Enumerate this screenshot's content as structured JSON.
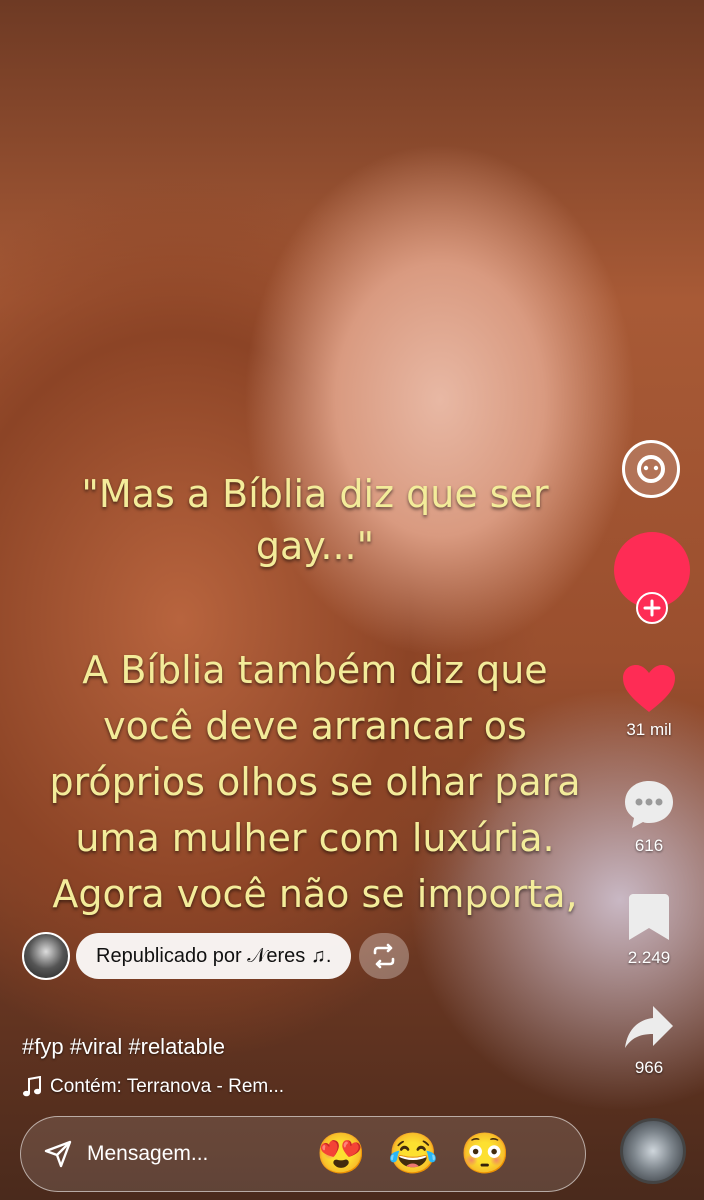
{
  "caption": {
    "quote_lines": [
      "\"Mas a Bíblia diz que ser",
      "gay...\""
    ],
    "answer_lines": [
      "A Bíblia também diz que",
      "você deve arrancar os",
      "próprios olhos se olhar para",
      "uma mulher com luxúria.",
      "Agora você não se importa,"
    ]
  },
  "sidebar": {
    "like_count": "31 mil",
    "comment_count": "616",
    "save_count": "2.249",
    "share_count": "966"
  },
  "repost": {
    "label": "Republicado por 𝒩eres ♫."
  },
  "description": {
    "hashtags": "#fyp #viral #relatable",
    "music": "Contém: Terranova - Rem..."
  },
  "message_bar": {
    "placeholder": "Mensagem..."
  },
  "quick_emojis": [
    "😍",
    "😂",
    "😳"
  ],
  "colors": {
    "caption_text": "#f3ec9a",
    "follow_accent": "#fe2c55",
    "like_heart": "#fe2c55"
  },
  "icons": [
    "search-icon",
    "avatar-icon",
    "follow-plus-icon",
    "heart-icon",
    "comment-icon",
    "bookmark-icon",
    "share-icon",
    "repost-icon",
    "music-note-icon",
    "send-icon"
  ]
}
